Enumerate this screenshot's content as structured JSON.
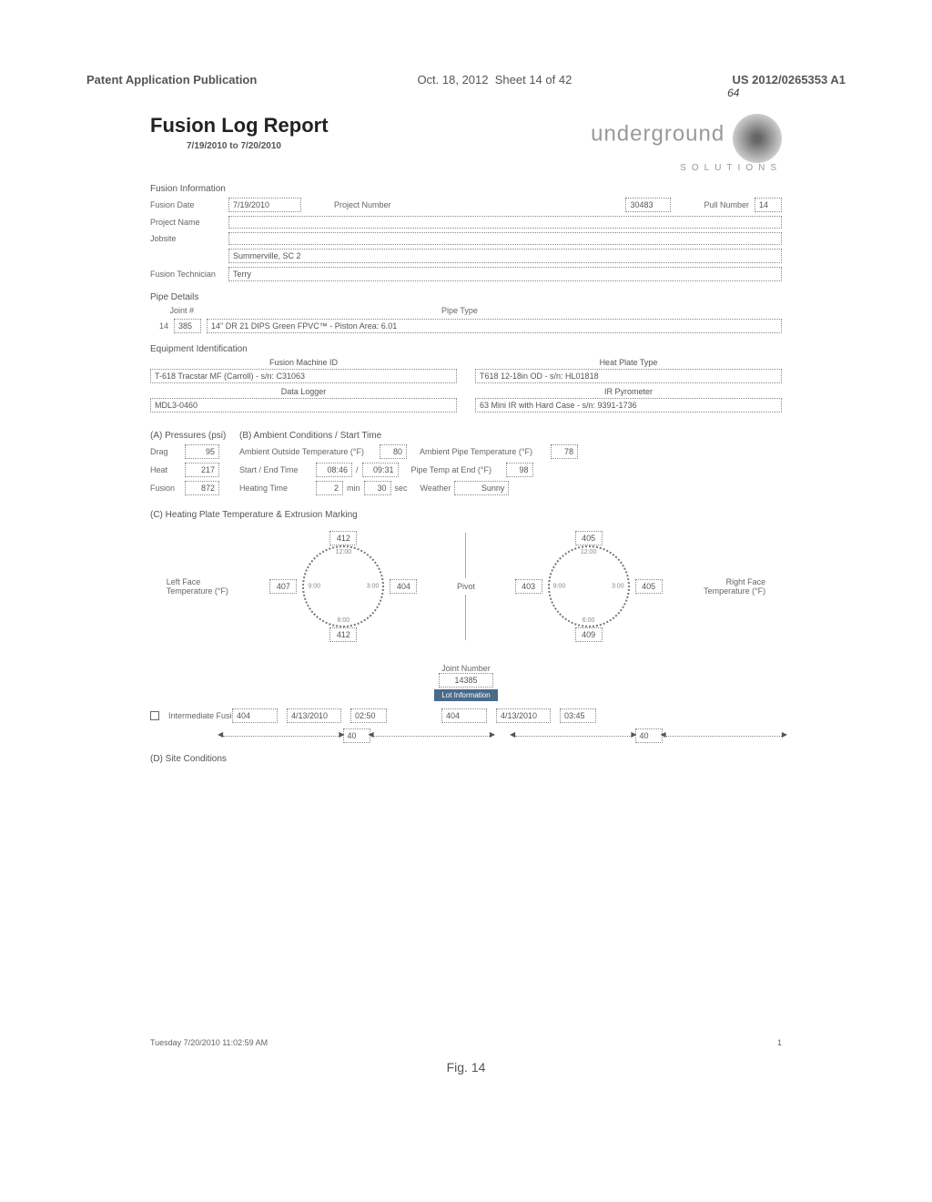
{
  "header": {
    "pub_left": "Patent Application Publication",
    "pub_date": "Oct. 18, 2012",
    "sheet": "Sheet 14 of 42",
    "pub_num": "US 2012/0265353 A1"
  },
  "report": {
    "title": "Fusion Log Report",
    "date_range": "7/19/2010 to 7/20/2010",
    "logo_text": "underground",
    "logo_sub": "SOLUTIONS",
    "ref_num": "64"
  },
  "fusion_info": {
    "section": "Fusion Information",
    "fusion_date_label": "Fusion Date",
    "fusion_date": "7/19/2010",
    "project_number_label": "Project Number",
    "project_number": "30483",
    "pull_number_label": "Pull Number",
    "pull_number": "14",
    "project_name_label": "Project Name",
    "project_name": "",
    "jobsite_label": "Jobsite",
    "jobsite1": "",
    "jobsite2": "Summerville, SC 2",
    "tech_label": "Fusion Technician",
    "tech": "Terry"
  },
  "pipe": {
    "section": "Pipe Details",
    "joint_label": "Joint #",
    "joint_prefix": "14",
    "joint_num": "385",
    "pipe_type_label": "Pipe Type",
    "pipe_type": "14\" DR 21 DIPS Green FPVC™ - Piston Area: 6.01"
  },
  "equip": {
    "section": "Equipment Identification",
    "machine_label": "Fusion Machine ID",
    "machine": "T-618 Tracstar MF (Carroll) - s/n: C31063",
    "heat_plate_label": "Heat Plate Type",
    "heat_plate": "T618 12-18in OD - s/n: HL01818",
    "logger_label": "Data Logger",
    "logger": "MDL3-0460",
    "pyrometer_label": "IR Pyrometer",
    "pyrometer": "63 Mini IR with Hard Case - s/n: 9391-1736"
  },
  "pressures": {
    "section": "(A) Pressures (psi)",
    "drag_label": "Drag",
    "drag": "95",
    "heat_label": "Heat",
    "heat": "217",
    "fusion_label": "Fusion",
    "fusion": "872"
  },
  "conditions": {
    "section": "(B) Ambient Conditions / Start Time",
    "amb_temp_label": "Ambient Outside Temperature (°F)",
    "amb_temp": "80",
    "pipe_temp_label": "Ambient Pipe Temperature (°F)",
    "pipe_temp": "78",
    "start_end_label": "Start / End Time",
    "start_time": "08:46",
    "end_time": "09:31",
    "pipe_end_label": "Pipe Temp at End (°F)",
    "pipe_end": "98",
    "heating_label": "Heating Time",
    "heating_min": "2",
    "heating_min_unit": "min",
    "heating_sec": "30",
    "heating_sec_unit": "sec",
    "weather_label": "Weather",
    "weather": "Sunny"
  },
  "heating": {
    "section": "(C) Heating Plate Temperature & Extrusion Marking",
    "left_label": "Left Face Temperature (°F)",
    "right_label": "Right Face Temperature (°F)",
    "pivot_label": "Pivot",
    "joint_number_label": "Joint Number",
    "joint_number": "14385",
    "lot_info": "Lot Information",
    "left": {
      "t12": "412",
      "t3": "404",
      "t6": "412",
      "t9": "407"
    },
    "right": {
      "t12": "405",
      "t3": "405",
      "t6": "409",
      "t9": "403"
    },
    "clock": {
      "c12": "12:00",
      "c3": "3:00",
      "c6": "6:00",
      "c9": "9:00"
    }
  },
  "intermediate": {
    "label": "Intermediate Fusion",
    "left_v1": "404",
    "left_v2": "4/13/2010",
    "left_v3": "02:50",
    "right_v1": "404",
    "right_v2": "4/13/2010",
    "right_v3": "03:45",
    "len_left": "40",
    "len_right": "40"
  },
  "site": {
    "section": "(D) Site Conditions"
  },
  "footer": {
    "timestamp": "Tuesday 7/20/2010 11:02:59 AM",
    "page": "1",
    "fig": "Fig. 14"
  }
}
